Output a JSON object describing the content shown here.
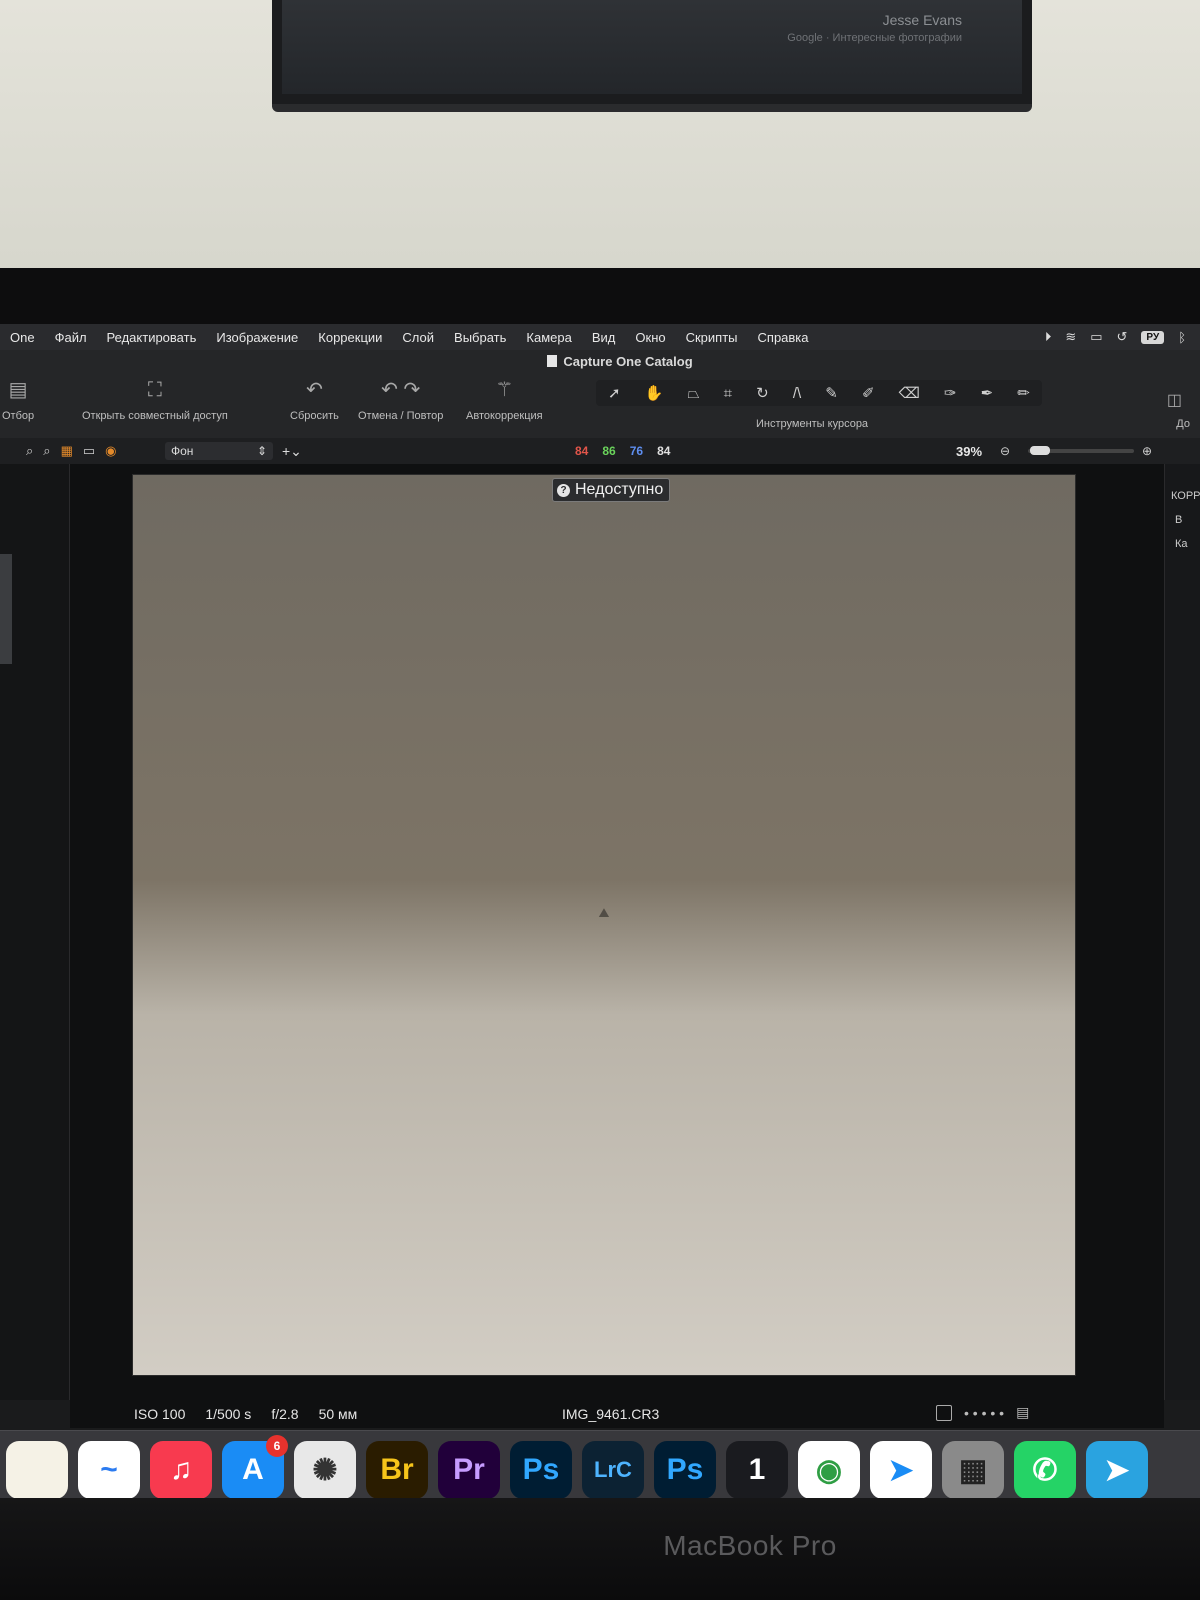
{
  "tv": {
    "line1": "Jesse Evans",
    "line2": "Google · Интересные фотографии"
  },
  "menu": {
    "app": "One",
    "items": [
      "Файл",
      "Редактировать",
      "Изображение",
      "Коррекции",
      "Слой",
      "Выбрать",
      "Камера",
      "Вид",
      "Окно",
      "Скрипты",
      "Справка"
    ],
    "lang": "РУ"
  },
  "window": {
    "title": "Capture One Catalog"
  },
  "toolbar": {
    "select_label": "Отбор",
    "share_label": "Открыть совместный доступ",
    "reset_label": "Сбросить",
    "undo_redo_label": "Отмена / Повтор",
    "auto_label": "Автокоррекция",
    "cursor_tools_label": "Инструменты курсора",
    "right_label": "До"
  },
  "viewer": {
    "layer_select": "Фон",
    "rgb": {
      "r": "84",
      "g": "86",
      "b": "76",
      "l": "84"
    },
    "zoom": "39%",
    "unavailable": "Недоступно",
    "right_panel": {
      "t1": "КОРР",
      "t2": "В",
      "t3": "Ка"
    }
  },
  "info": {
    "iso": "ISO 100",
    "shutter": "1/500 s",
    "aperture": "f/2.8",
    "focal": "50 мм",
    "filename": "IMG_9461.CR3"
  },
  "dock": {
    "apps": [
      {
        "name": "Заметки",
        "text": "",
        "bg": "#f5f2e6",
        "fg": "#000"
      },
      {
        "name": "Freeform",
        "text": "~",
        "bg": "#ffffff",
        "fg": "#2b7bf0"
      },
      {
        "name": "Музыка",
        "text": "♫",
        "bg": "#f83a4f",
        "fg": "#fff"
      },
      {
        "name": "App Store",
        "text": "A",
        "bg": "#1a8cf5",
        "fg": "#fff",
        "badge": "6"
      },
      {
        "name": "Aperture",
        "text": "✺",
        "bg": "#e8e8e8",
        "fg": "#333"
      },
      {
        "name": "Bridge",
        "text": "Br",
        "bg": "#2a1c00",
        "fg": "#f6c51a"
      },
      {
        "name": "Premiere Pro",
        "text": "Pr",
        "bg": "#21003a",
        "fg": "#c69cff"
      },
      {
        "name": "Photoshop",
        "text": "Ps",
        "bg": "#001d33",
        "fg": "#31a8ff"
      },
      {
        "name": "Lightroom Classic",
        "text": "LrC",
        "bg": "#0c2233",
        "fg": "#4eb4ff"
      },
      {
        "name": "Photoshop",
        "text": "Ps",
        "bg": "#001d33",
        "fg": "#31a8ff"
      },
      {
        "name": "Capture One",
        "text": "1",
        "bg": "#1a1b1f",
        "fg": "#fff"
      },
      {
        "name": "Chrome",
        "text": "◉",
        "bg": "#ffffff",
        "fg": "#2f9e44"
      },
      {
        "name": "Safari",
        "text": "➤",
        "bg": "#ffffff",
        "fg": "#1a8cf5"
      },
      {
        "name": "Фото-утилита",
        "text": "▦",
        "bg": "#8a8a8a",
        "fg": "#222"
      },
      {
        "name": "WhatsApp",
        "text": "✆",
        "bg": "#25d366",
        "fg": "#fff"
      },
      {
        "name": "Telegram",
        "text": "➤",
        "bg": "#2aa3e0",
        "fg": "#fff"
      }
    ]
  },
  "hardware": {
    "brand": "MacBook Pro"
  },
  "colors": {
    "accent": "#e48a2a",
    "red": "#e2554a",
    "green": "#6ad35b",
    "blue": "#5e8ef0"
  }
}
